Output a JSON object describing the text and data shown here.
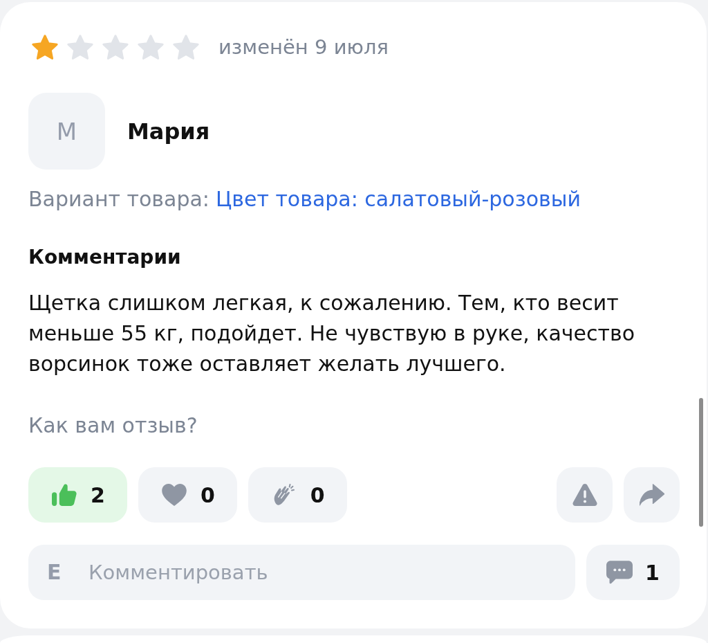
{
  "review": {
    "stars": 1,
    "date": "изменён 9 июля",
    "author": {
      "initial": "М",
      "name": "Мария"
    },
    "variant": {
      "label": "Вариант товара:",
      "value": "Цвет товара: салатовый-розовый"
    },
    "comment_heading": "Комментарии",
    "comment_text": "Щетка слишком легкая, к сожалению. Тем, кто весит меньше 55 кг, подойдет. Не чувствую в руке, качество ворсинок тоже оставляет желать лучшего.",
    "feedback_prompt": "Как вам отзыв?",
    "reactions": [
      {
        "kind": "like",
        "count": "2",
        "selected": true
      },
      {
        "kind": "heart",
        "count": "0",
        "selected": false
      },
      {
        "kind": "clap",
        "count": "0",
        "selected": false
      }
    ],
    "actions": [
      {
        "kind": "report"
      },
      {
        "kind": "share"
      }
    ],
    "comment_field": {
      "initial": "Е",
      "placeholder": "Комментировать"
    },
    "comments": {
      "count": "1"
    }
  }
}
